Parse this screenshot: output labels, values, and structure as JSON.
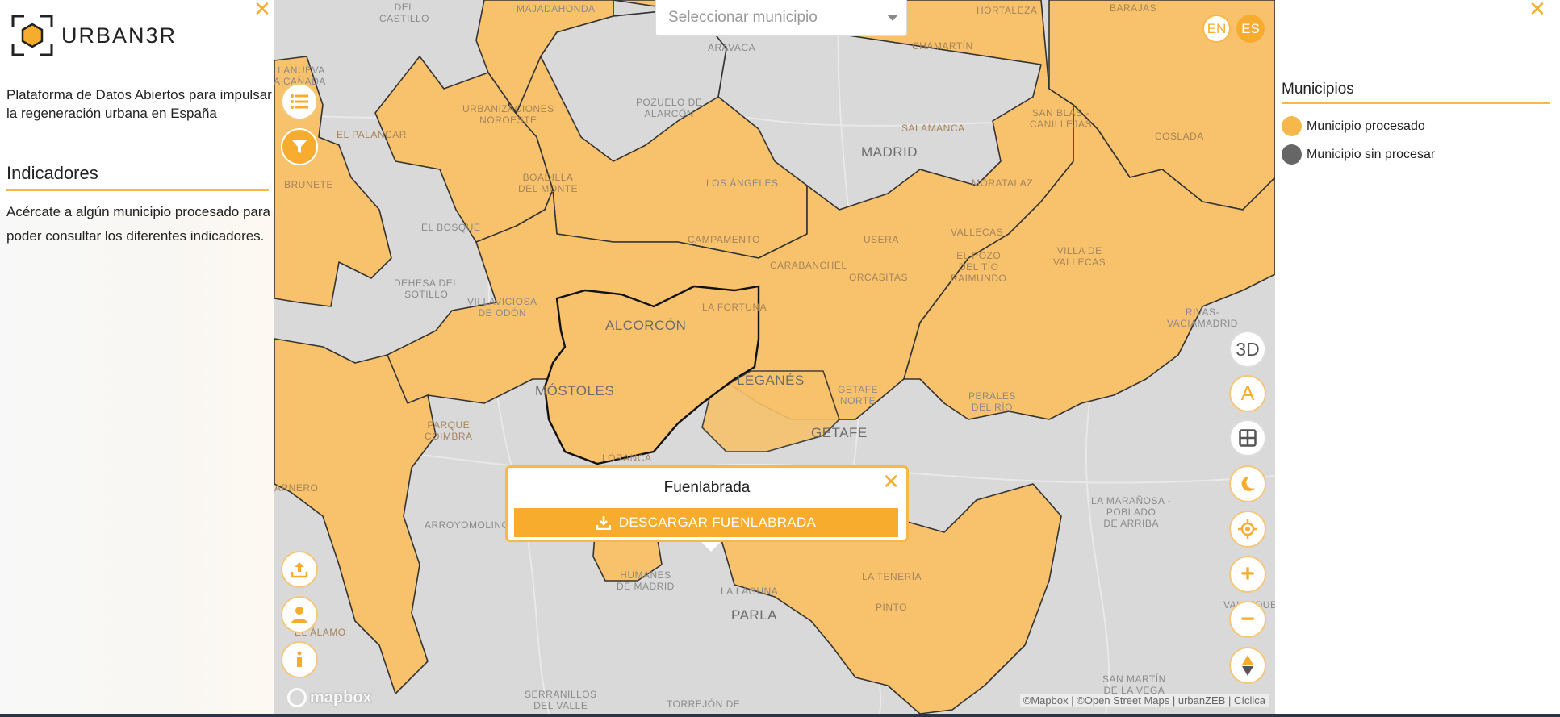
{
  "app": {
    "brand": "URBAN3R"
  },
  "left_panel": {
    "intro": "Plataforma de Datos Abiertos para impulsar la regeneración urbana en España",
    "indicators_title": "Indicadores",
    "indicators_text": "Acércate a algún municipio procesado para poder consultar los diferentes indicadores."
  },
  "map": {
    "search_placeholder": "Seleccionar municipio",
    "lang_en": "EN",
    "lang_es": "ES",
    "labels": {
      "el_castillo": "DEL\nCASTILLO",
      "majadahonda": "MAJADAHONDA",
      "aravaca": "ARAVACA",
      "hortaleza": "HORTALEZA",
      "barajas": "BARAJAS",
      "chamartin": "CHAMARTÍN",
      "villanueva": "ILLANUEVA\nLA CAÑADA",
      "urbanizaciones": "URBANIZACIONES\nNOROESTE",
      "pozuelo": "POZUELO DE\nALARCÓN",
      "san_blas": "SAN BLAS -\nCANILLEJAS",
      "salamanca": "SALAMANCA",
      "coslada": "COSLADA",
      "palancar": "EL PALANCAR",
      "madrid": "MADRID",
      "boadilla": "BOADILLA\nDEL MONTE",
      "brunete": "BRUNETE",
      "los_angeles": "LOS ÁNGELES",
      "moratalaz": "MORATALAZ",
      "el_bosque": "EL BOSQUE",
      "campamento": "CAMPAMENTO",
      "usera": "USERA",
      "vallecas": "VALLECAS",
      "villa_vallecas": "VILLA DE\nVALLECAS",
      "carabanchel": "CARABANCHEL",
      "orcasitas": "ORCASITAS",
      "el_pozo": "EL POZO\nDEL TÍO\nRAIMUNDO",
      "dehesa": "DEHESA DEL\nSOTILLO",
      "villaviciosa": "VILLAVICIOSA\nDE ODÓN",
      "la_fortuna": "LA FORTUNA",
      "rivas": "RIVAS-\nVACIAMADRID",
      "alcorcon": "ALCORCÓN",
      "leganes": "LEGANÉS",
      "mostoles": "MÓSTOLES",
      "getafe_norte": "GETAFE\nNORTE",
      "perales": "PERALES\nDEL RÍO",
      "parque_coimbra": "PARQUE\nCOIMBRA",
      "getafe": "GETAFE",
      "loranca": "LORANCA",
      "arnero": "ARNERO",
      "arroyomolinos": "ARROYOMOLINOS",
      "maranosa": "LA MARAÑOSA -\nPOBLADO\nDE ARRIBA",
      "humanes": "HUMANES\nDE MADRID",
      "la_teneria": "LA TENERÍA",
      "la_laguna": "LA LAGUNA",
      "pinto": "PINTO",
      "parla": "PARLA",
      "valleque": "VALLEQUE\nNOR",
      "el_alamo": "EL ÁLAMO",
      "san_martin": "SAN MARTÍN\nDE LA VEGA",
      "serranillos": "SERRANILLOS\nDEL VALLE",
      "torrejon": "TORREJÓN DE"
    },
    "popup": {
      "title": "Fuenlabrada",
      "download_label": "DESCARGAR FUENLABRADA"
    },
    "controls": {
      "btn_3d": "3D",
      "btn_a": "A",
      "btn_plus": "+",
      "btn_minus": "−"
    },
    "mapbox_logo": "mapbox",
    "attribution": "©Mapbox | ©Open Street Maps | urbanZEB | Cíclica",
    "colors": {
      "processed": "#f8c26c",
      "unprocessed": "#d9d9da",
      "accent": "#f7ac2e"
    }
  },
  "legend": {
    "title": "Municipios",
    "processed": "Municipio procesado",
    "unprocessed": "Municipio sin procesar",
    "processed_color": "#f7b84b",
    "unprocessed_color": "#666666"
  }
}
